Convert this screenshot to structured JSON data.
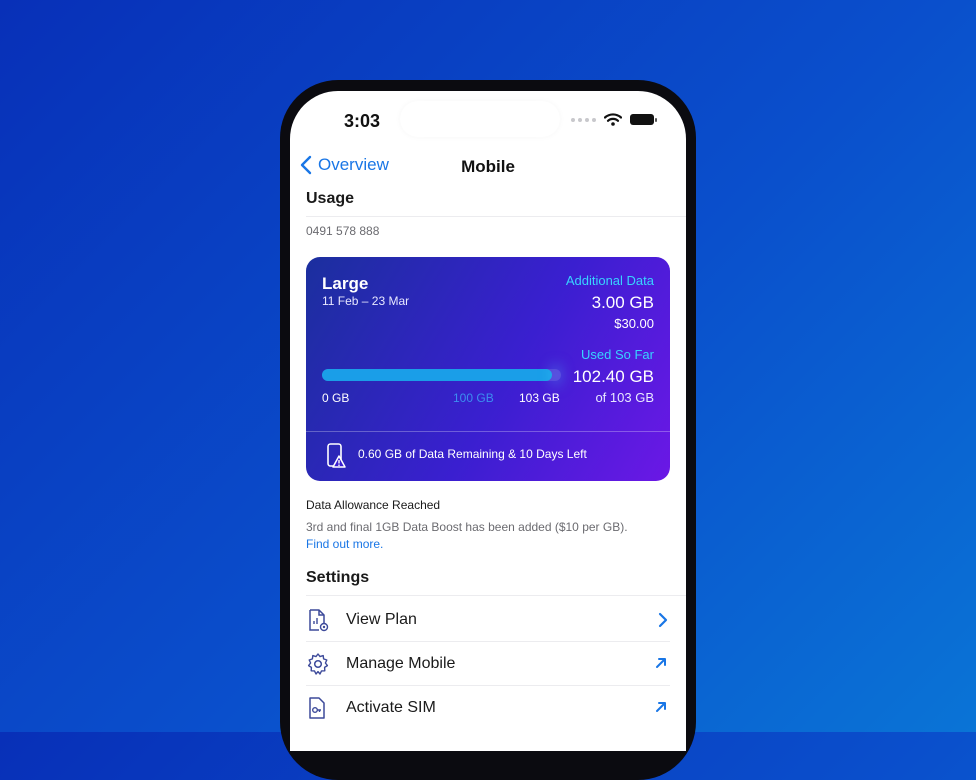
{
  "status_bar": {
    "time": "3:03"
  },
  "nav": {
    "back_label": "Overview",
    "title": "Mobile"
  },
  "usage": {
    "section_title": "Usage",
    "phone_number": "0491 578 888",
    "card": {
      "plan_name": "Large",
      "dates": "11 Feb – 23 Mar",
      "additional_label": "Additional Data",
      "additional_amount": "3.00 GB",
      "additional_price": "$30.00",
      "used_label": "Used So Far",
      "used_amount": "102.40 GB",
      "used_of": "of 103 GB",
      "bar": {
        "used_gb": 102.4,
        "allowance_gb": 100,
        "max_gb": 103
      },
      "ticks": {
        "start": "0 GB",
        "allowance": "100 GB",
        "max": "103 GB"
      },
      "remaining_text": "0.60 GB of Data Remaining & 10 Days Left"
    },
    "notice_title": "Data Allowance Reached",
    "notice_body": "3rd and final 1GB Data Boost has been added ($10 per GB).",
    "notice_link": "Find out more."
  },
  "settings": {
    "section_title": "Settings",
    "items": [
      {
        "label": "View Plan",
        "icon": "document-chart-icon",
        "arrow": "chevron-right-icon"
      },
      {
        "label": "Manage Mobile",
        "icon": "gear-icon",
        "arrow": "external-arrow-icon"
      },
      {
        "label": "Activate SIM",
        "icon": "sim-key-icon",
        "arrow": "external-arrow-icon"
      }
    ]
  },
  "colors": {
    "accent": "#1976e6",
    "card_start": "#1b2f9e",
    "card_end": "#6b18e6",
    "highlight": "#38d3ff",
    "background": "#0a4fcc"
  }
}
